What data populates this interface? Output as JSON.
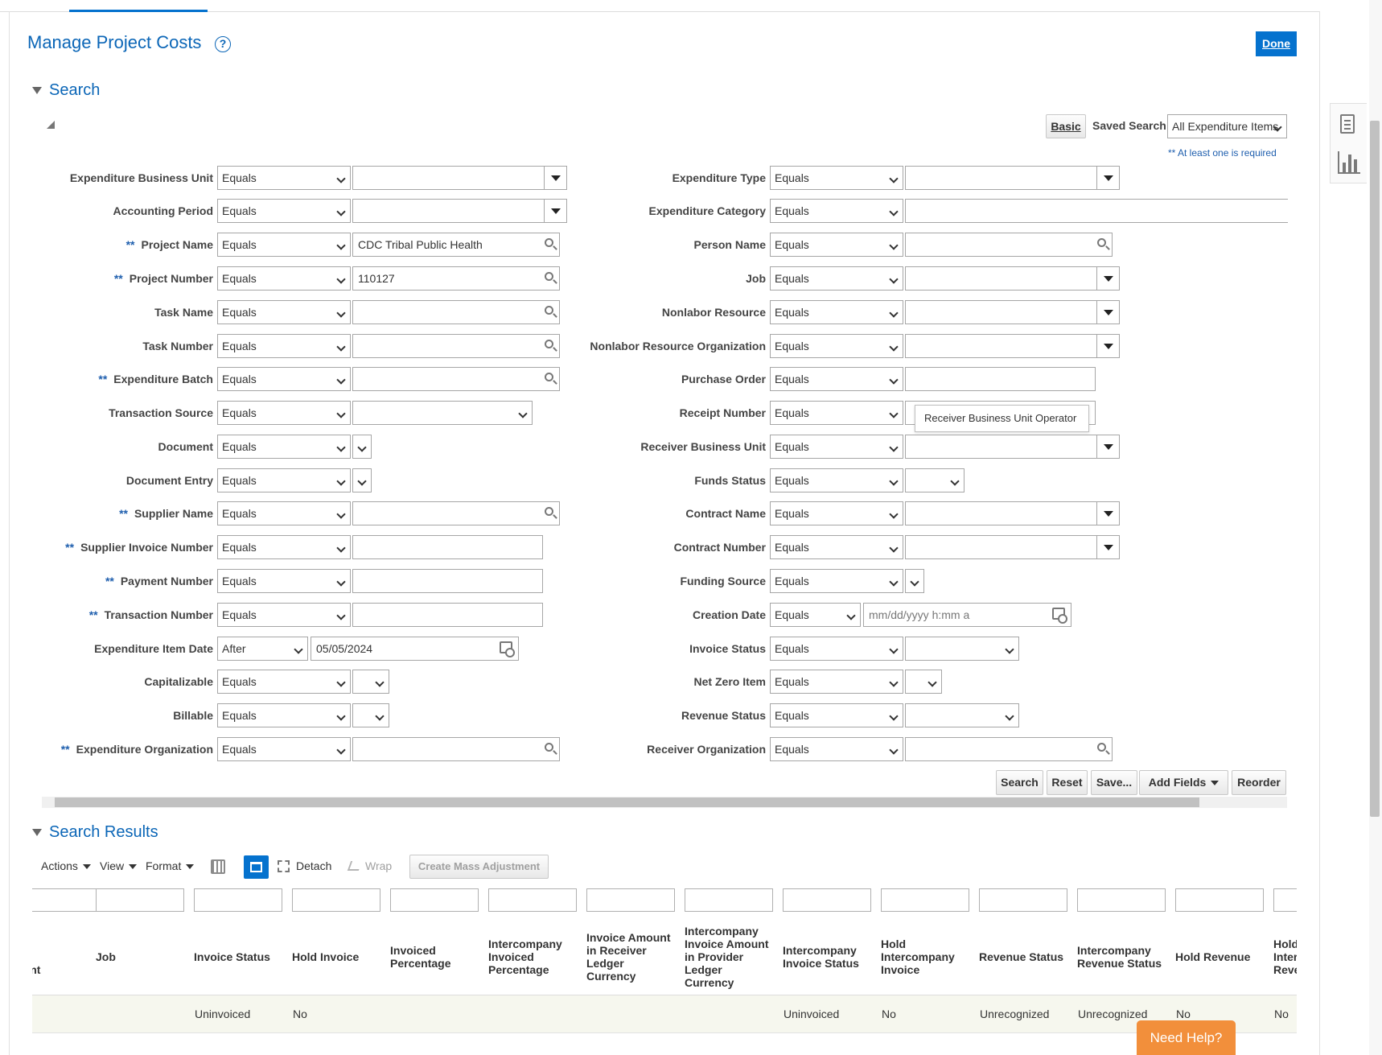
{
  "header": {
    "title": "Manage Project Costs",
    "help_icon": "?",
    "done_label": "Done"
  },
  "search": {
    "section_title": "Search",
    "basic_label": "Basic",
    "saved_search_label": "Saved Search",
    "saved_search_value": "All Expenditure Items",
    "required_note": "** At least one is required",
    "left_fields": [
      {
        "label": "Expenditure Business Unit",
        "required": "",
        "operator": "Equals",
        "kind": "lov",
        "value": ""
      },
      {
        "label": "Accounting Period",
        "required": "",
        "operator": "Equals",
        "kind": "lov",
        "value": ""
      },
      {
        "label": "Project Name",
        "required": "**",
        "operator": "Equals",
        "kind": "search",
        "value": "CDC Tribal Public Health"
      },
      {
        "label": "Project Number",
        "required": "**",
        "operator": "Equals",
        "kind": "search",
        "value": "110127"
      },
      {
        "label": "Task Name",
        "required": "",
        "operator": "Equals",
        "kind": "search",
        "value": ""
      },
      {
        "label": "Task Number",
        "required": "",
        "operator": "Equals",
        "kind": "search",
        "value": ""
      },
      {
        "label": "Expenditure Batch",
        "required": "**",
        "operator": "Equals",
        "kind": "search",
        "value": ""
      },
      {
        "label": "Transaction Source",
        "required": "",
        "operator": "Equals",
        "kind": "select-wide",
        "value": ""
      },
      {
        "label": "Document",
        "required": "",
        "operator": "Equals",
        "kind": "select-tiny",
        "value": ""
      },
      {
        "label": "Document Entry",
        "required": "",
        "operator": "Equals",
        "kind": "select-tiny",
        "value": ""
      },
      {
        "label": "Supplier Name",
        "required": "**",
        "operator": "Equals",
        "kind": "search",
        "value": ""
      },
      {
        "label": "Supplier Invoice Number",
        "required": "**",
        "operator": "Equals",
        "kind": "text",
        "value": ""
      },
      {
        "label": "Payment Number",
        "required": "**",
        "operator": "Equals",
        "kind": "text",
        "value": ""
      },
      {
        "label": "Transaction Number",
        "required": "**",
        "operator": "Equals",
        "kind": "text",
        "value": ""
      },
      {
        "label": "Expenditure Item Date",
        "required": "",
        "operator": "After",
        "kind": "date",
        "value": "05/05/2024"
      },
      {
        "label": "Capitalizable",
        "required": "",
        "operator": "Equals",
        "kind": "select-small",
        "value": ""
      },
      {
        "label": "Billable",
        "required": "",
        "operator": "Equals",
        "kind": "select-small",
        "value": ""
      },
      {
        "label": "Expenditure Organization",
        "required": "**",
        "operator": "Equals",
        "kind": "search",
        "value": ""
      }
    ],
    "right_fields": [
      {
        "label": "Expenditure Type",
        "operator": "Equals",
        "kind": "lov",
        "value": ""
      },
      {
        "label": "Expenditure Category",
        "operator": "Equals",
        "kind": "text-long",
        "value": ""
      },
      {
        "label": "Person Name",
        "operator": "Equals",
        "kind": "search",
        "value": ""
      },
      {
        "label": "Job",
        "operator": "Equals",
        "kind": "lov",
        "value": ""
      },
      {
        "label": "Nonlabor Resource",
        "operator": "Equals",
        "kind": "lov",
        "value": ""
      },
      {
        "label": "Nonlabor Resource Organization",
        "operator": "Equals",
        "kind": "lov",
        "value": ""
      },
      {
        "label": "Purchase Order",
        "operator": "Equals",
        "kind": "text",
        "value": ""
      },
      {
        "label": "Receipt Number",
        "operator": "Equals",
        "kind": "text",
        "value": ""
      },
      {
        "label": "Receiver Business Unit",
        "operator": "Equals",
        "kind": "lov",
        "value": ""
      },
      {
        "label": "Funds Status",
        "operator": "Equals",
        "kind": "select-small",
        "value": ""
      },
      {
        "label": "Contract Name",
        "operator": "Equals",
        "kind": "lov",
        "value": ""
      },
      {
        "label": "Contract Number",
        "operator": "Equals",
        "kind": "lov",
        "value": ""
      },
      {
        "label": "Funding Source",
        "operator": "Equals",
        "kind": "select-tiny",
        "value": ""
      },
      {
        "label": "Creation Date",
        "operator": "Equals",
        "kind": "datetime",
        "value": "mm/dd/yyyy h:mm a"
      },
      {
        "label": "Invoice Status",
        "operator": "Equals",
        "kind": "select-mid",
        "value": ""
      },
      {
        "label": "Net Zero Item",
        "operator": "Equals",
        "kind": "select-small",
        "value": ""
      },
      {
        "label": "Revenue Status",
        "operator": "Equals",
        "kind": "select-mid",
        "value": ""
      },
      {
        "label": "Receiver Organization",
        "operator": "Equals",
        "kind": "search",
        "value": ""
      }
    ],
    "tooltip": "Receiver Business Unit Operator",
    "buttons": {
      "search": "Search",
      "reset": "Reset",
      "save": "Save...",
      "add_fields": "Add Fields",
      "reorder": "Reorder"
    }
  },
  "results": {
    "section_title": "Search Results",
    "toolbar": {
      "actions": "Actions",
      "view": "View",
      "format": "Format",
      "detach": "Detach",
      "wrap": "Wrap",
      "mass_adjust": "Create Mass Adjustment"
    },
    "columns": [
      "n\nrce\nment",
      "Job",
      "Invoice Status",
      "Hold Invoice",
      "Invoiced\nPercentage",
      "Intercompany\nInvoiced\nPercentage",
      "Invoice Amount\nin Receiver\nLedger\nCurrency",
      "Intercompany\nInvoice Amount\nin Provider\nLedger\nCurrency",
      "Intercompany\nInvoice Status",
      "Hold\nIntercompany\nInvoice",
      "Revenue Status",
      "Intercompany\nRevenue Status",
      "Hold Revenue",
      "Hold\nInter\nReve"
    ],
    "row": [
      "",
      "",
      "Uninvoiced",
      "No",
      "",
      "",
      "",
      "",
      "Uninvoiced",
      "No",
      "Unrecognized",
      "Unrecognized",
      "No",
      "No"
    ]
  },
  "help_pill": "Need Help?",
  "colors": {
    "accent": "#0572ce",
    "title": "#0b66b7",
    "help_pill": "#f28f3b",
    "row_bg": "#f6f7ee"
  }
}
